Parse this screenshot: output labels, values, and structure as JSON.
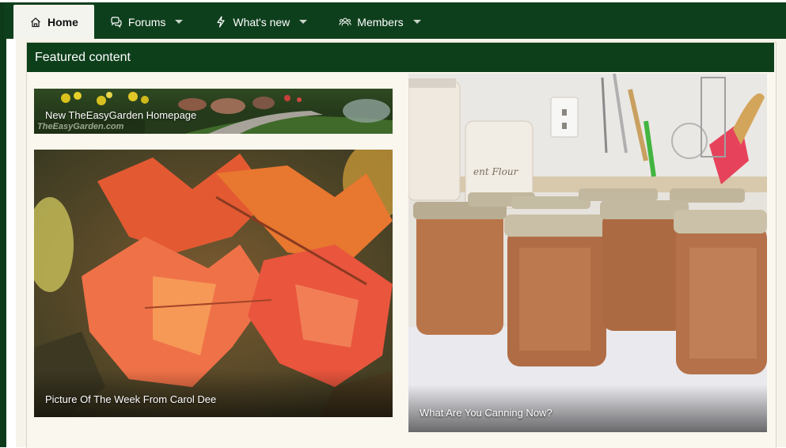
{
  "nav": {
    "tabs": [
      {
        "label": "Home",
        "icon": "home-icon",
        "active": true,
        "has_menu": false
      },
      {
        "label": "Forums",
        "icon": "forums-icon",
        "active": false,
        "has_menu": true
      },
      {
        "label": "What's new",
        "icon": "lightning-icon",
        "active": false,
        "has_menu": true
      },
      {
        "label": "Members",
        "icon": "members-icon",
        "active": false,
        "has_menu": true
      }
    ]
  },
  "featured": {
    "title": "Featured content",
    "items": [
      {
        "caption": "New TheEasyGarden Homepage",
        "logo_text": "TheEasyGarden.com"
      },
      {
        "caption": "Picture Of The Week From Carol Dee"
      },
      {
        "caption": "What Are You Canning Now?",
        "jar_label": "ent Flour"
      }
    ]
  },
  "colors": {
    "nav_bg": "#0e3f1c",
    "header_bg": "#0d3f1b",
    "panel_bg": "#faf7ee",
    "active_tab_bg": "#f3f4ee"
  }
}
